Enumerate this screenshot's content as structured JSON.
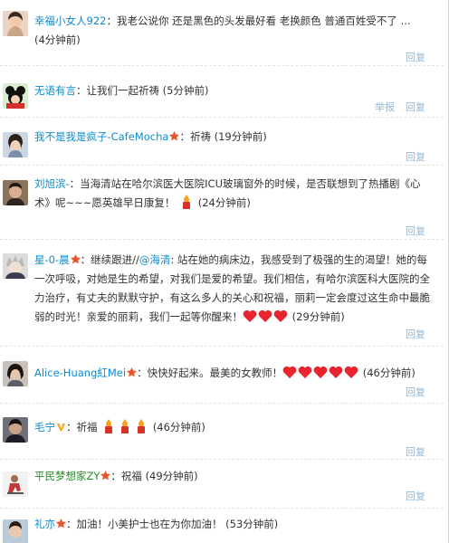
{
  "comments": [
    {
      "user": "幸福小女人922",
      "text": "我老公说你 还是黑色的头发最好看 老换颜色 普通百姓受不了 ...",
      "time": "(4分钟前)",
      "actions": [
        "回复"
      ],
      "avatar_icon": "woman-portrait-avatar"
    },
    {
      "user": "无语有言",
      "text": "让我们一起祈祷",
      "time": "(5分钟前)",
      "actions": [
        "举报",
        "回复"
      ],
      "avatar_icon": "mickey-avatar"
    },
    {
      "user": "我不是我是疯子-CafeMocha",
      "text": "祈祷",
      "time": "(19分钟前)",
      "actions": [
        "回复"
      ],
      "avatar_icon": "girl-portrait-avatar"
    },
    {
      "user": "刘旭滨-",
      "text": "当海清站在哈尔滨医大医院ICU玻璃窗外的时候，是否联想到了热播剧《心术》呢~~~愿英雄早日康复！",
      "time": "(24分钟前)",
      "actions": [
        "回复"
      ],
      "avatar_icon": "man-portrait-avatar"
    },
    {
      "user": "星-0-晨",
      "mention": "@海清",
      "text_before": "继续跟进//",
      "text": ": 站在她的病床边，我感受到了极强的生的渴望！她的每一次呼吸，对她是生的希望，对我们是爱的希望。我们相信，有哈尔滨医科大医院的全力治疗，有丈夫的默默守护，有这么多人的关心和祝福，丽莉一定会度过这生命中最脆弱的时光！亲爱的丽莉，我们一起等你醒来！",
      "time": "(29分钟前)",
      "actions": [
        "回复"
      ],
      "avatar_icon": "anime-character-avatar"
    },
    {
      "user": "Alice-Huang紅Mei",
      "text": "快快好起来。最美的女教师！",
      "time": "(46分钟前)",
      "actions": [
        "回复"
      ],
      "avatar_icon": "woman-dark-hair-avatar"
    },
    {
      "user": "毛宁",
      "text": "祈福",
      "time": "(46分钟前)",
      "actions": [
        "回复"
      ],
      "avatar_icon": "man-singer-avatar"
    },
    {
      "user": "平民梦想家ZY",
      "text": "祝福",
      "time": "(49分钟前)",
      "actions": [
        "回复"
      ],
      "avatar_icon": "figure-sitting-avatar"
    },
    {
      "user": "礼亦",
      "text": "加油！小美护士也在为你加油！",
      "time": "(53分钟前)",
      "actions": [],
      "avatar_icon": "person-portrait-avatar"
    }
  ],
  "colors": {
    "link": "#0a8cd2",
    "link_green": "#2a8a2a",
    "reply": "#8fb8da",
    "heart": "#e8242e",
    "candle_flame": "#f7a21b",
    "badge": "#e8552b"
  }
}
